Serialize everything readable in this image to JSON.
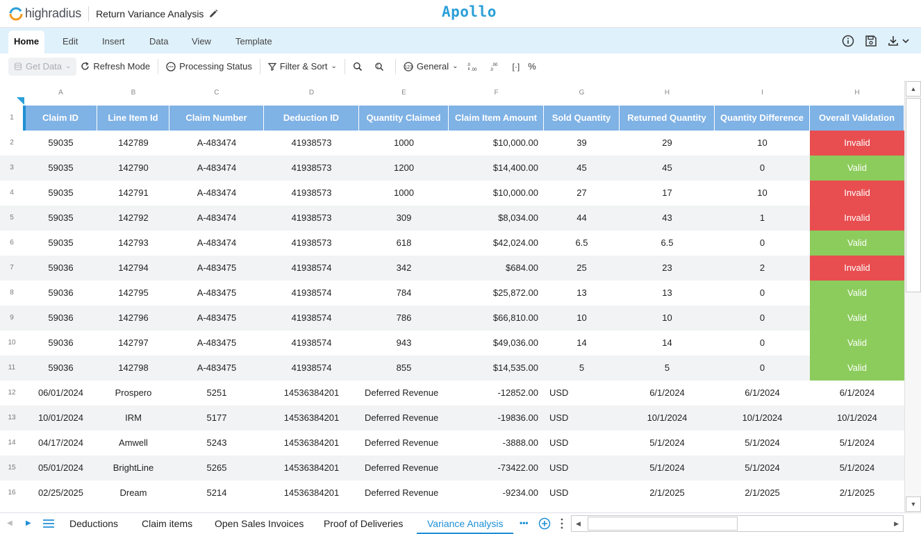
{
  "app": {
    "brand": "highradius",
    "document_title": "Return Variance Analysis",
    "product": "Apollo",
    "accent_color": "#2a9fd8"
  },
  "ribbon": {
    "tabs": [
      "Home",
      "Edit",
      "Insert",
      "Data",
      "View",
      "Template"
    ],
    "active_tab": "Home",
    "right_icons": [
      "info-icon",
      "save-icon",
      "download-icon"
    ]
  },
  "toolbar": {
    "get_data": "Get Data",
    "refresh_mode": "Refresh Mode",
    "processing_status": "Processing Status",
    "filter_sort": "Filter & Sort",
    "number_format": "General",
    "percent": "%",
    "bracket": "[·]"
  },
  "grid": {
    "column_letters": [
      "A",
      "B",
      "C",
      "D",
      "E",
      "F",
      "G",
      "H",
      "I",
      "H"
    ],
    "headers": [
      "Claim ID",
      "Line Item Id",
      "Claim Number",
      "Deduction ID",
      "Quantity Claimed",
      "Claim Item Amount",
      "Sold Quantity",
      "Returned Quantity",
      "Quantity Difference",
      "Overall Validation"
    ],
    "row_numbers": [
      "1",
      "2",
      "3",
      "4",
      "5",
      "6",
      "7",
      "8",
      "9",
      "10",
      "11",
      "12",
      "13",
      "14",
      "15",
      "16"
    ],
    "rows": [
      [
        "59035",
        "142789",
        "A-483474",
        "41938573",
        "1000",
        "$10,000.00",
        "39",
        "29",
        "10",
        "Invalid"
      ],
      [
        "59035",
        "142790",
        "A-483474",
        "41938573",
        "1200",
        "$14,400.00",
        "45",
        "45",
        "0",
        "Valid"
      ],
      [
        "59035",
        "142791",
        "A-483474",
        "41938573",
        "1000",
        "$10,000.00",
        "27",
        "17",
        "10",
        "Invalid"
      ],
      [
        "59035",
        "142792",
        "A-483474",
        "41938573",
        "309",
        "$8,034.00",
        "44",
        "43",
        "1",
        "Invalid"
      ],
      [
        "59035",
        "142793",
        "A-483474",
        "41938573",
        "618",
        "$42,024.00",
        "6.5",
        "6.5",
        "0",
        "Valid"
      ],
      [
        "59036",
        "142794",
        "A-483475",
        "41938574",
        "342",
        "$684.00",
        "25",
        "23",
        "2",
        "Invalid"
      ],
      [
        "59036",
        "142795",
        "A-483475",
        "41938574",
        "784",
        "$25,872.00",
        "13",
        "13",
        "0",
        "Valid"
      ],
      [
        "59036",
        "142796",
        "A-483475",
        "41938574",
        "786",
        "$66,810.00",
        "10",
        "10",
        "0",
        "Valid"
      ],
      [
        "59036",
        "142797",
        "A-483475",
        "41938574",
        "943",
        "$49,036.00",
        "14",
        "14",
        "0",
        "Valid"
      ],
      [
        "59036",
        "142798",
        "A-483475",
        "41938574",
        "855",
        "$14,535.00",
        "5",
        "5",
        "0",
        "Valid"
      ],
      [
        "06/01/2024",
        "Prospero",
        "5251",
        "14536384201",
        "Deferred Revenue",
        "-12852.00",
        "USD",
        "6/1/2024",
        "6/1/2024",
        "6/1/2024"
      ],
      [
        "10/01/2024",
        "IRM",
        "5177",
        "14536384201",
        "Deferred Revenue",
        "-19836.00",
        "USD",
        "10/1/2024",
        "10/1/2024",
        "10/1/2024"
      ],
      [
        "04/17/2024",
        "Amwell",
        "5243",
        "14536384201",
        "Deferred Revenue",
        "-3888.00",
        "USD",
        "5/1/2024",
        "5/1/2024",
        "5/1/2024"
      ],
      [
        "05/01/2024",
        "BrightLine",
        "5265",
        "14536384201",
        "Deferred Revenue",
        "-73422.00",
        "USD",
        "5/1/2024",
        "5/1/2024",
        "5/1/2024"
      ],
      [
        "02/25/2025",
        "Dream",
        "5214",
        "14536384201",
        "Deferred Revenue",
        "-9234.00",
        "USD",
        "2/1/2025",
        "2/1/2025",
        "2/1/2025"
      ]
    ],
    "status_colors": {
      "Invalid": "#e84e50",
      "Valid": "#8ccc5c"
    },
    "header_color": "#7fb2e5"
  },
  "sheets": {
    "tabs": [
      "Deductions",
      "Claim items",
      "Open Sales Invoices",
      "Proof of Deliveries",
      "Variance Analysis"
    ],
    "active_tab": "Variance Analysis",
    "more": "•••"
  }
}
